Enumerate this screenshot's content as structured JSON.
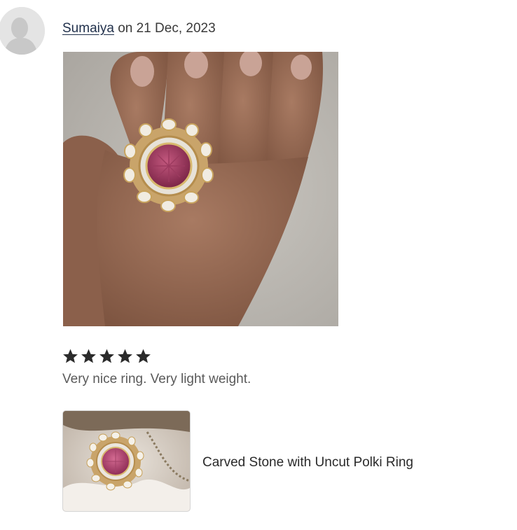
{
  "review": {
    "reviewer_name": "Sumaiya",
    "date_text": " on 21 Dec, 2023",
    "rating": 5,
    "rating_max": 5,
    "text": "Very nice ring. Very light weight."
  },
  "product": {
    "name": "Carved Stone with Uncut Polki Ring"
  },
  "colors": {
    "star": "#2b2b2b",
    "text": "#5a5a5a",
    "link": "#1f2f4a"
  }
}
